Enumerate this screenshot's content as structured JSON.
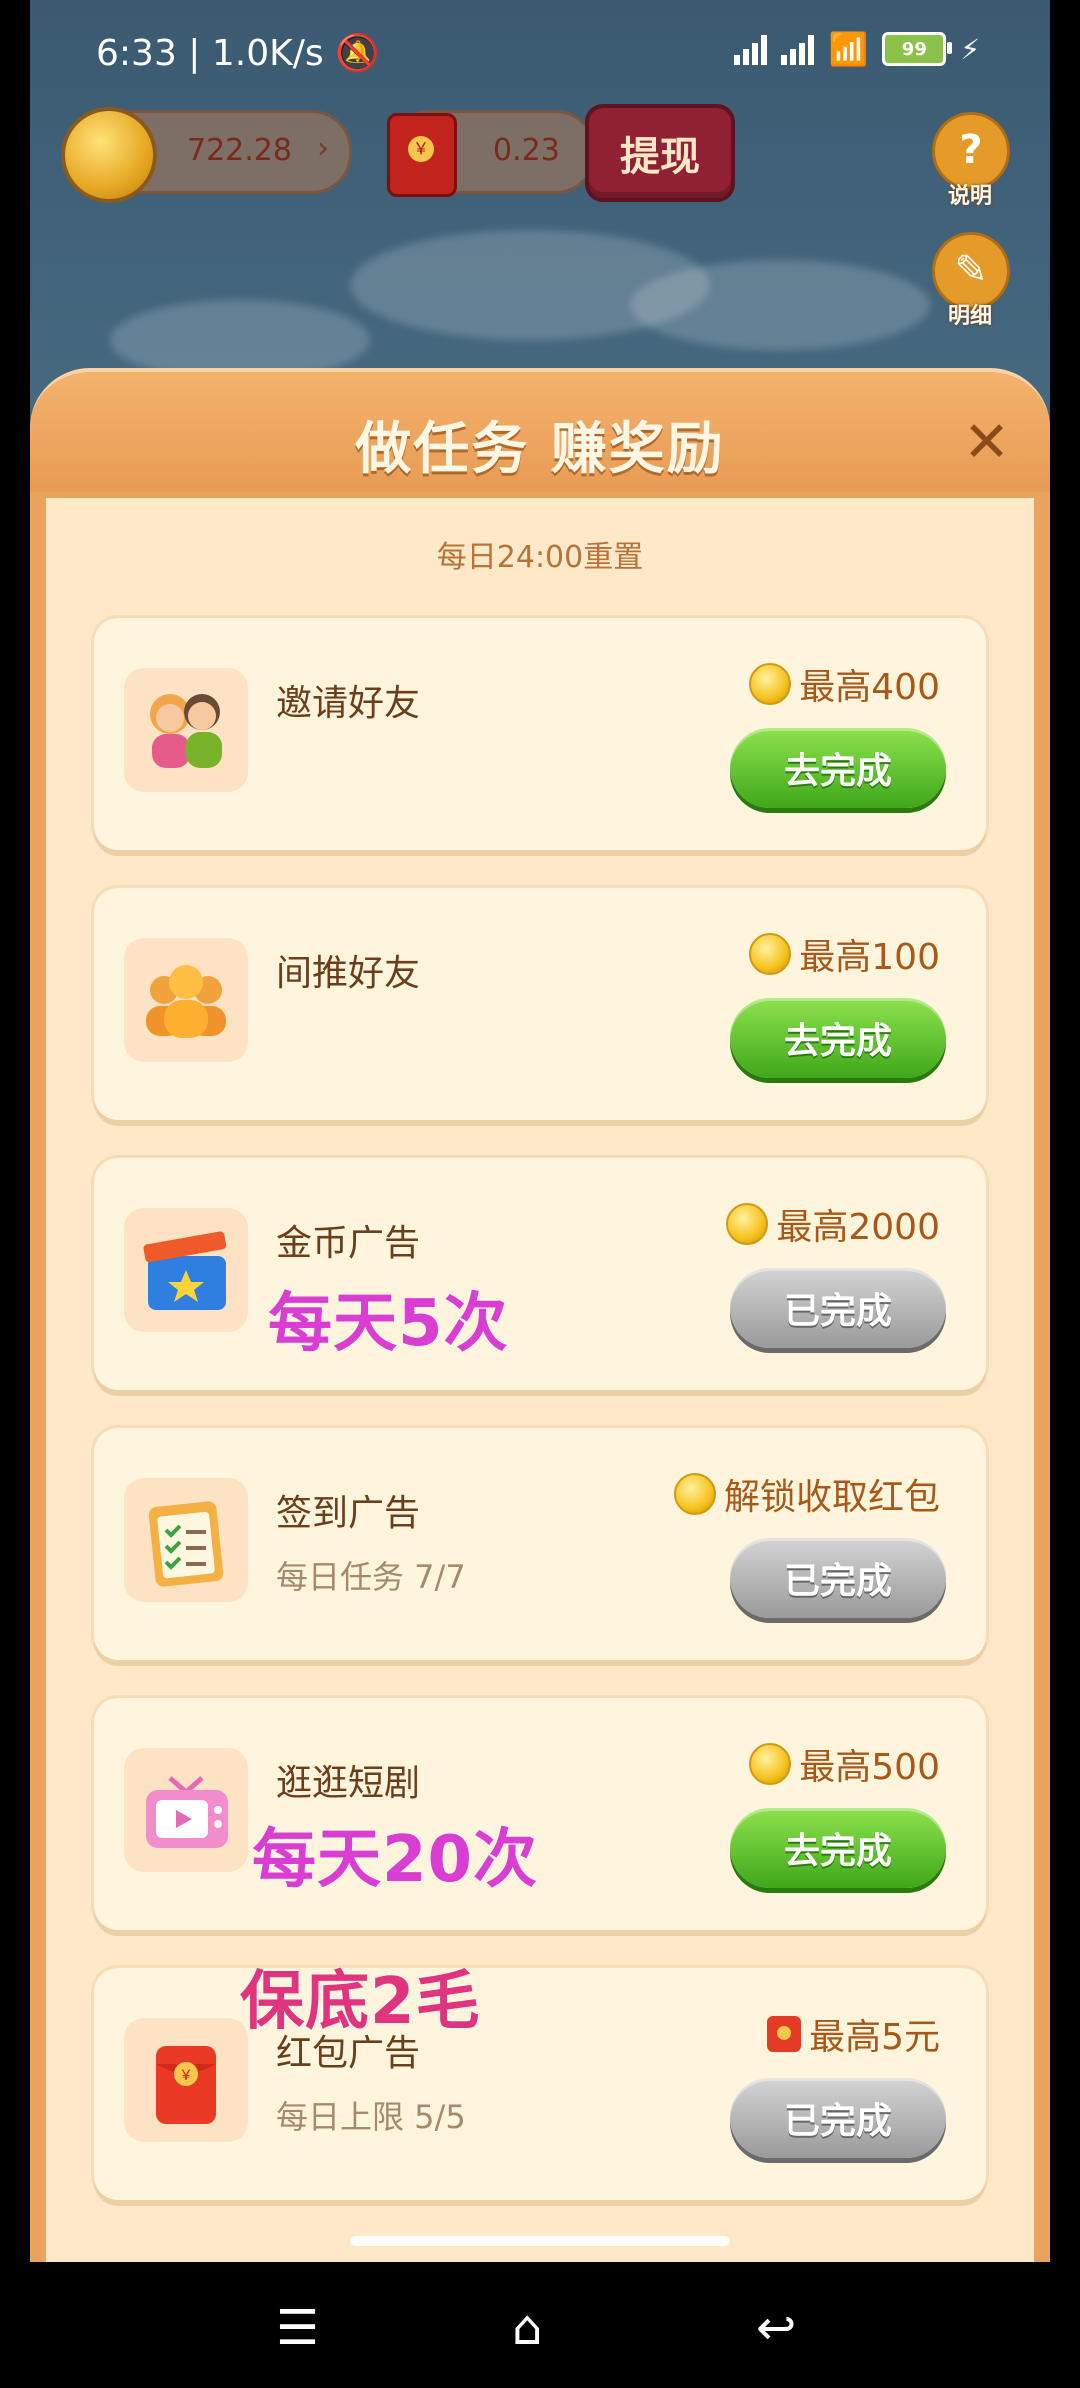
{
  "status_bar": {
    "time": "6:33",
    "speed": "1.0K/s",
    "battery": "99"
  },
  "top": {
    "coins": "722.28",
    "cash": "0.23",
    "withdraw_label": "提现",
    "help_label": "说明",
    "detail_label": "明细"
  },
  "modal": {
    "title": "做任务 赚奖励",
    "close_glyph": "✕",
    "reset_note": "每日24:00重置"
  },
  "tasks": [
    {
      "title": "邀请好友",
      "sub": "",
      "reward": "最高400",
      "button": "去完成",
      "state": "active"
    },
    {
      "title": "间推好友",
      "sub": "",
      "reward": "最高100",
      "button": "去完成",
      "state": "active"
    },
    {
      "title": "金币广告",
      "sub": "",
      "reward": "最高2000",
      "button": "已完成",
      "state": "done"
    },
    {
      "title": "签到广告",
      "sub": "每日任务 7/7",
      "reward": "解锁收取红包",
      "button": "已完成",
      "state": "done"
    },
    {
      "title": "逛逛短剧",
      "sub": "",
      "reward": "最高500",
      "button": "去完成",
      "state": "active"
    },
    {
      "title": "红包广告",
      "sub": "每日上限 5/5",
      "reward": "最高5元",
      "button": "已完成",
      "state": "done"
    }
  ],
  "annotations": {
    "gold_ad": "每天5次",
    "drama": "每天20次",
    "redpacket": "保底2毛"
  },
  "colors": {
    "go_button": "#3fa81a",
    "done_button": "#9a9a9a",
    "annotation_purple": "#d93dd1",
    "annotation_pink": "#e0357e"
  }
}
